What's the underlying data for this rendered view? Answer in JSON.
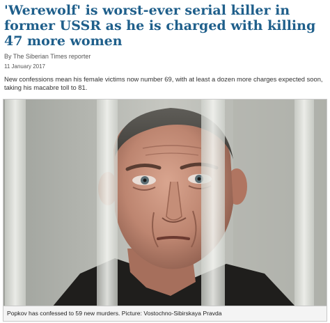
{
  "article": {
    "headline": "'Werewolf' is worst-ever serial killer in former USSR as he is charged with killing 47 more women",
    "byline": "By The Siberian Times reporter",
    "date": "11 January 2017",
    "standfirst": "New confessions mean his female victims now number 69, with at least a dozen more charges expected soon, taking his macabre toll to 81.",
    "photo_caption": "Popkov has confessed to 59 new murders. Picture: Vostochno-Sibirskaya Pravda"
  },
  "colors": {
    "headline": "#1f5f8b",
    "body_text": "#333333",
    "meta_text": "#555555"
  }
}
